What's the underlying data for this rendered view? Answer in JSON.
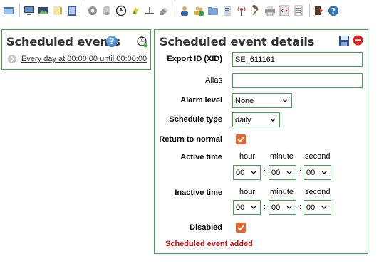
{
  "toolbar": {
    "icons": [
      "window-icon",
      "monitor-icon",
      "image-icon",
      "note-icon",
      "book-icon",
      "gear-icon",
      "database-icon",
      "clock-icon",
      "plug-icon",
      "scale-icon",
      "eraser-icon",
      "user-icon",
      "users-icon",
      "folder-icon",
      "document-icon",
      "antenna-icon",
      "hammer-icon",
      "printer-icon",
      "code-icon",
      "page-icon",
      "logout-icon",
      "help-icon"
    ]
  },
  "left_panel": {
    "title": "Scheduled events",
    "help": "?",
    "events": [
      {
        "label": "Every day at 00:00:00 until 00:00:00"
      }
    ]
  },
  "right_panel": {
    "title": "Scheduled event details",
    "fields": {
      "export_id": {
        "label": "Export ID (XID)",
        "value": "SE_611161"
      },
      "alias": {
        "label": "Alias",
        "value": ""
      },
      "alarm_level": {
        "label": "Alarm level",
        "value": "None"
      },
      "schedule_type": {
        "label": "Schedule type",
        "value": "daily"
      },
      "return_to_normal": {
        "label": "Return to normal",
        "checked": true
      },
      "active_time": {
        "label": "Active time",
        "hour": "00",
        "minute": "00",
        "second": "00"
      },
      "inactive_time": {
        "label": "Inactive time",
        "hour": "00",
        "minute": "00",
        "second": "00"
      },
      "disabled": {
        "label": "Disabled",
        "checked": true
      }
    },
    "time_headers": {
      "hour": "hour",
      "minute": "minute",
      "second": "second"
    },
    "colon": ":",
    "status": "Scheduled event added"
  },
  "colors": {
    "border": "#3fa34d",
    "checkbox": "#e8642a",
    "status": "#cc1111"
  }
}
